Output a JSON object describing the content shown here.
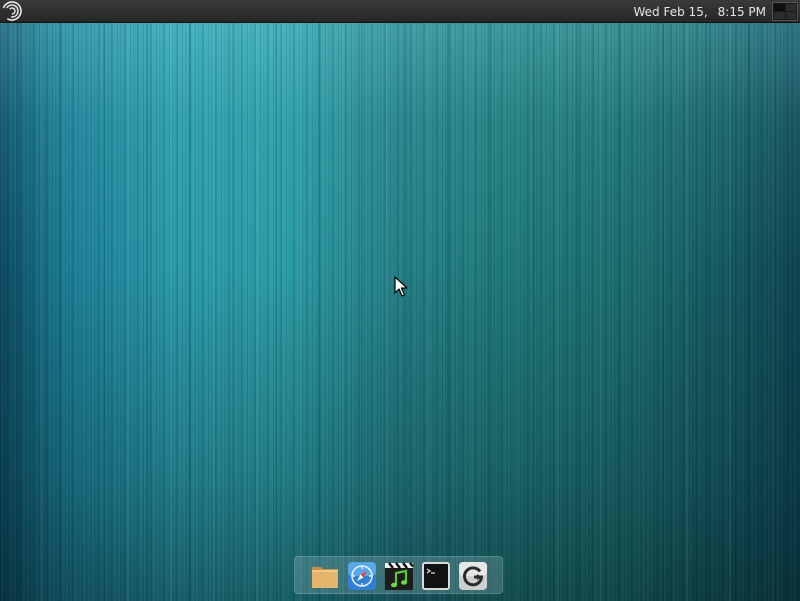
{
  "top_panel": {
    "menu_icon": "swirl-logo-icon",
    "clock": {
      "date": "Wed Feb 15,",
      "time": "8:15 PM"
    },
    "workspace_switcher_icon": "workspace-switcher-icon"
  },
  "dock": {
    "items": [
      {
        "icon": "folder-icon"
      },
      {
        "icon": "compass-icon"
      },
      {
        "icon": "media-player-icon"
      },
      {
        "icon": "terminal-icon"
      },
      {
        "icon": "refresh-icon"
      }
    ]
  },
  "colors": {
    "panel": "#2e2e2e",
    "wallpaper_primary": "#1f7a7a",
    "wallpaper_light": "#2b9da6",
    "folder": "#e3b068",
    "compass": "#3a8fe0",
    "media_note": "#5fcf3a"
  }
}
